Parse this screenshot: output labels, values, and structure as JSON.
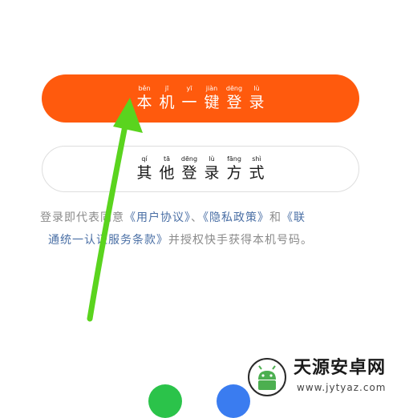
{
  "primary_button": {
    "chars": [
      {
        "py": "běn",
        "hz": "本"
      },
      {
        "py": "jī",
        "hz": "机"
      },
      {
        "py": "yī",
        "hz": "一"
      },
      {
        "py": "jiàn",
        "hz": "键"
      },
      {
        "py": "dēng",
        "hz": "登"
      },
      {
        "py": "lù",
        "hz": "录"
      }
    ]
  },
  "secondary_button": {
    "chars": [
      {
        "py": "qí",
        "hz": "其"
      },
      {
        "py": "tā",
        "hz": "他"
      },
      {
        "py": "dēng",
        "hz": "登"
      },
      {
        "py": "lù",
        "hz": "录"
      },
      {
        "py": "fāng",
        "hz": "方"
      },
      {
        "py": "shì",
        "hz": "式"
      }
    ]
  },
  "agreement": {
    "prefix": "登录即代表同意",
    "user_agreement": "《用户协议》",
    "separator": "、",
    "privacy_policy": "《隐私政策》",
    "and": "和",
    "unicom_terms_part1": "《联",
    "unicom_terms_part2": "通统一认证服务条款》",
    "suffix": "并授权快手获得本机号码。"
  },
  "watermark": {
    "title": "天源安卓网",
    "url": "www.jytyaz.com"
  },
  "colors": {
    "primary": "#ff5a0d",
    "arrow": "#5ad41e",
    "link": "#4a6fa5",
    "muted_text": "#8a8a8a"
  },
  "icons": {
    "bottom_left": "wechat-icon",
    "bottom_right": "person-icon",
    "watermark_logo": "android-icon"
  }
}
